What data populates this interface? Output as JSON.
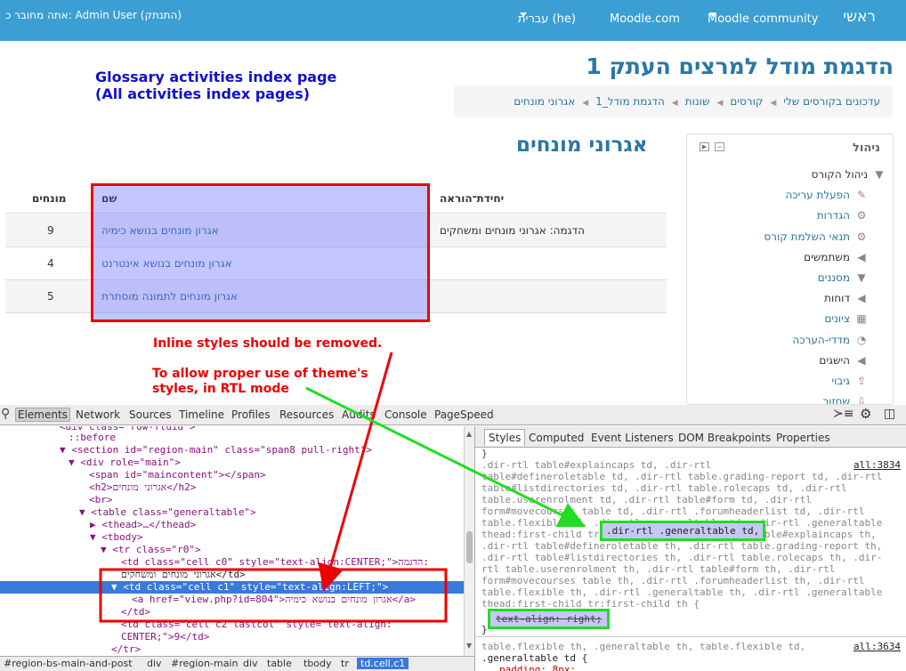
{
  "topbar": {
    "home": "ראשי",
    "community": "Moodle community",
    "moodle_com": "Moodle.com",
    "language": "עברית (he)",
    "user_info": "אתה מחובר כ: Admin User (התנתק)"
  },
  "site_title": "הדגמת מודל למרצים העתק 1",
  "breadcrumb": [
    "עדכונים בקורסים שלי",
    "קורסים",
    "שונות",
    "הדגמת מודל_1",
    "אגרוני מונחים"
  ],
  "annotations": {
    "title_line1": "Glossary activities index page",
    "title_line2": "(All activities index pages)",
    "inline_remove": "Inline styles should be removed.",
    "allow_line1": "To allow proper use of theme's",
    "allow_line2": "styles, in RTL mode"
  },
  "page_heading": "אגרוני מונחים",
  "navigation": {
    "title": "ניהול",
    "items": [
      {
        "label": "ניהול הקורס",
        "icon": "caret-down-icon",
        "link": false
      },
      {
        "label": "הפעלת עריכה",
        "icon": "pencil-icon",
        "link": true
      },
      {
        "label": "הגדרות",
        "icon": "gear-icon",
        "link": true
      },
      {
        "label": "תנאי השלמת קורס",
        "icon": "gear-icon",
        "link": true
      },
      {
        "label": "משתמשים",
        "icon": "caret-left-icon",
        "link": false
      },
      {
        "label": "מסננים",
        "icon": "filter-icon",
        "link": true
      },
      {
        "label": "דוחות",
        "icon": "caret-left-icon",
        "link": false
      },
      {
        "label": "ציונים",
        "icon": "grid-icon",
        "link": true
      },
      {
        "label": "מדדי-הערכה",
        "icon": "chart-icon",
        "link": true
      },
      {
        "label": "הישגים",
        "icon": "caret-left-icon",
        "link": false
      },
      {
        "label": "גיבוי",
        "icon": "upload-icon",
        "link": true
      },
      {
        "label": "שחזור",
        "icon": "download-icon",
        "link": true
      }
    ]
  },
  "table": {
    "headers": {
      "unit": "יחידת־הוראה",
      "name": "שם",
      "entries": "מונחים"
    },
    "rows": [
      {
        "unit": "הדגמה: אגרוני מונחים ומשחקים",
        "name": "אגרון מונחים בנושא כימיה",
        "entries": "9"
      },
      {
        "unit": "",
        "name": "אגרון מונחים בנושא אינטרנט",
        "entries": "4"
      },
      {
        "unit": "",
        "name": "אגרון מונחים לתמונה מוסתרת",
        "entries": "5"
      }
    ]
  },
  "devtools": {
    "tabs": [
      "Elements",
      "Network",
      "Sources",
      "Timeline",
      "Profiles",
      "Resources",
      "Audits",
      "Console",
      "PageSpeed"
    ],
    "dom_lines": [
      "<div class=\"row-fluid\">",
      "::before",
      "<section id=\"region-main\" class=\"span8 pull-right\">",
      "<div role=\"main\">",
      "<span id=\"maincontent\"></span>",
      "<h2>אגרוני מונחים</h2>",
      "<br>",
      "<table class=\"generaltable\">",
      "<thead>…</thead>",
      "<tbody>",
      "<tr class=\"r0\">",
      "<td class=\"cell c0\" style=\"text-align:CENTER;\">הדגמה:",
      "אגרוני מונחים ומשחקים</td>",
      "<td class=\"cell c1\" style=\"text-align:LEFT;\">",
      "<a href=\"view.php?id=804\">אגרון מונחים בנושא כימיה</a>",
      "</td>",
      "<td class=\"cell c2 lastcol\" style=\"text-align:",
      "CENTER;\">9</td>",
      "</tr>"
    ],
    "styles_tabs": [
      "Styles",
      "Computed",
      "Event Listeners",
      "DOM Breakpoints",
      "Properties"
    ],
    "css_lines": [
      ".dir-rtl table#explaincaps td, .dir-rtl",
      "table#defineroletable td, .dir-rtl table.grading-report td, .dir-rtl",
      "table#listdirectories td, .dir-rtl table.rolecaps td, .dir-rtl",
      "table.userenrolment td, .dir-rtl table#form td, .dir-rtl",
      "form#movecourses table td, .dir-rtl .forumheaderlist td, .dir-rtl",
      "table.flexible td, .dir-rtl .generaltable td, .dir-rtl .generaltable",
      "thead:first-child tr:first-child td, .dir-rtl table#explaincaps th,",
      ".dir-rtl table#defineroletable th, .dir-rtl table.grading-report th,",
      ".dir-rtl table#listdirectories th, .dir-rtl table.rolecaps th, .dir-",
      "rtl table.userenrolment th, .dir-rtl table#form th, .dir-rtl",
      "form#movecourses table th, .dir-rtl .forumheaderlist th, .dir-rtl",
      "table.flexible th, .dir-rtl .generaltable th, .dir-rtl .generaltable",
      "thead:first-child tr:first-child th {"
    ],
    "css_source1": "all:3834",
    "css_highlight": ".dir-rtl .generaltable td,",
    "css_decl": "text-align: right;",
    "css_close": "}",
    "css2_line1": "table.flexible th, .generaltable th, table.flexible td,",
    "css2_line2": ".generaltable td {",
    "css2_line3": "padding: 8px;",
    "css_source2": "all:3634",
    "dom_breadcrumbs": [
      "#region-bs-main-and-post",
      "div",
      "#region-main",
      "div",
      "table",
      "tbody",
      "tr",
      "td.cell.c1"
    ]
  },
  "colors": {
    "topbar": "#3b9fd3",
    "link": "#2a77a2",
    "annotation_red": "#e00000",
    "annotation_green": "#22dd22",
    "annotation_blue": "#1010cc"
  }
}
